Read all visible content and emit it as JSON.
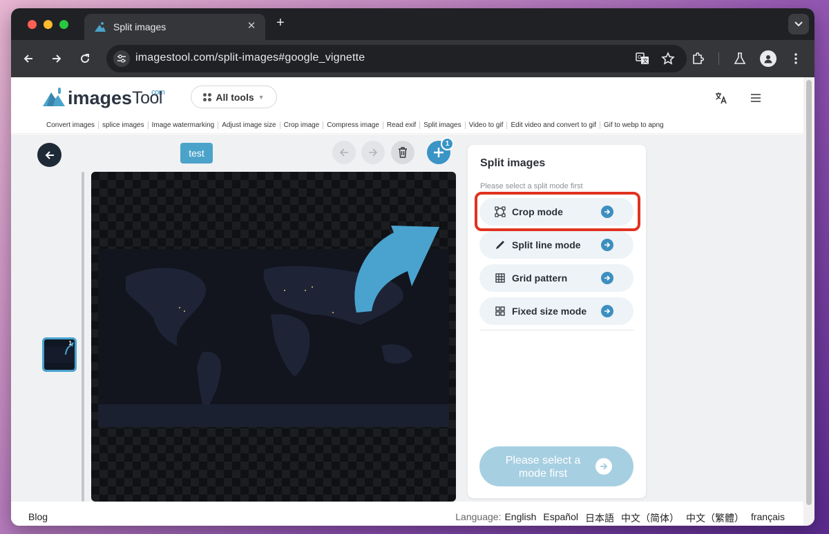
{
  "browser": {
    "tab_title": "Split images",
    "url": "imagestool.com/split-images#google_vignette"
  },
  "site": {
    "logo_text_main": "images",
    "logo_text_secondary": "Tool",
    "logo_superscript": "com",
    "all_tools_label": "All tools",
    "tool_nav": [
      "Convert images",
      "splice images",
      "Image watermarking",
      "Adjust image size",
      "Crop image",
      "Compress image",
      "Read exif",
      "Split images",
      "Video to gif",
      "Edit video and convert to gif",
      "Gif to webp to apng"
    ]
  },
  "editor": {
    "test_label": "test",
    "add_badge_count": "1",
    "thumbnail_badge": "1"
  },
  "panel": {
    "title": "Split images",
    "hint": "Please select a split mode first",
    "modes": [
      {
        "label": "Crop mode",
        "icon": "crop-icon"
      },
      {
        "label": "Split line mode",
        "icon": "knife-icon"
      },
      {
        "label": "Grid pattern",
        "icon": "grid-icon"
      },
      {
        "label": "Fixed size mode",
        "icon": "fixed-size-icon"
      }
    ],
    "submit_label": "Please select a mode first",
    "accent_color": "#3d8fbf",
    "highlight_color": "#e0321e"
  },
  "footer": {
    "blog": "Blog",
    "language_label": "Language:",
    "languages": [
      "English",
      "Español",
      "日本語",
      "中文（简体）",
      "中文（繁體）",
      "français"
    ]
  }
}
